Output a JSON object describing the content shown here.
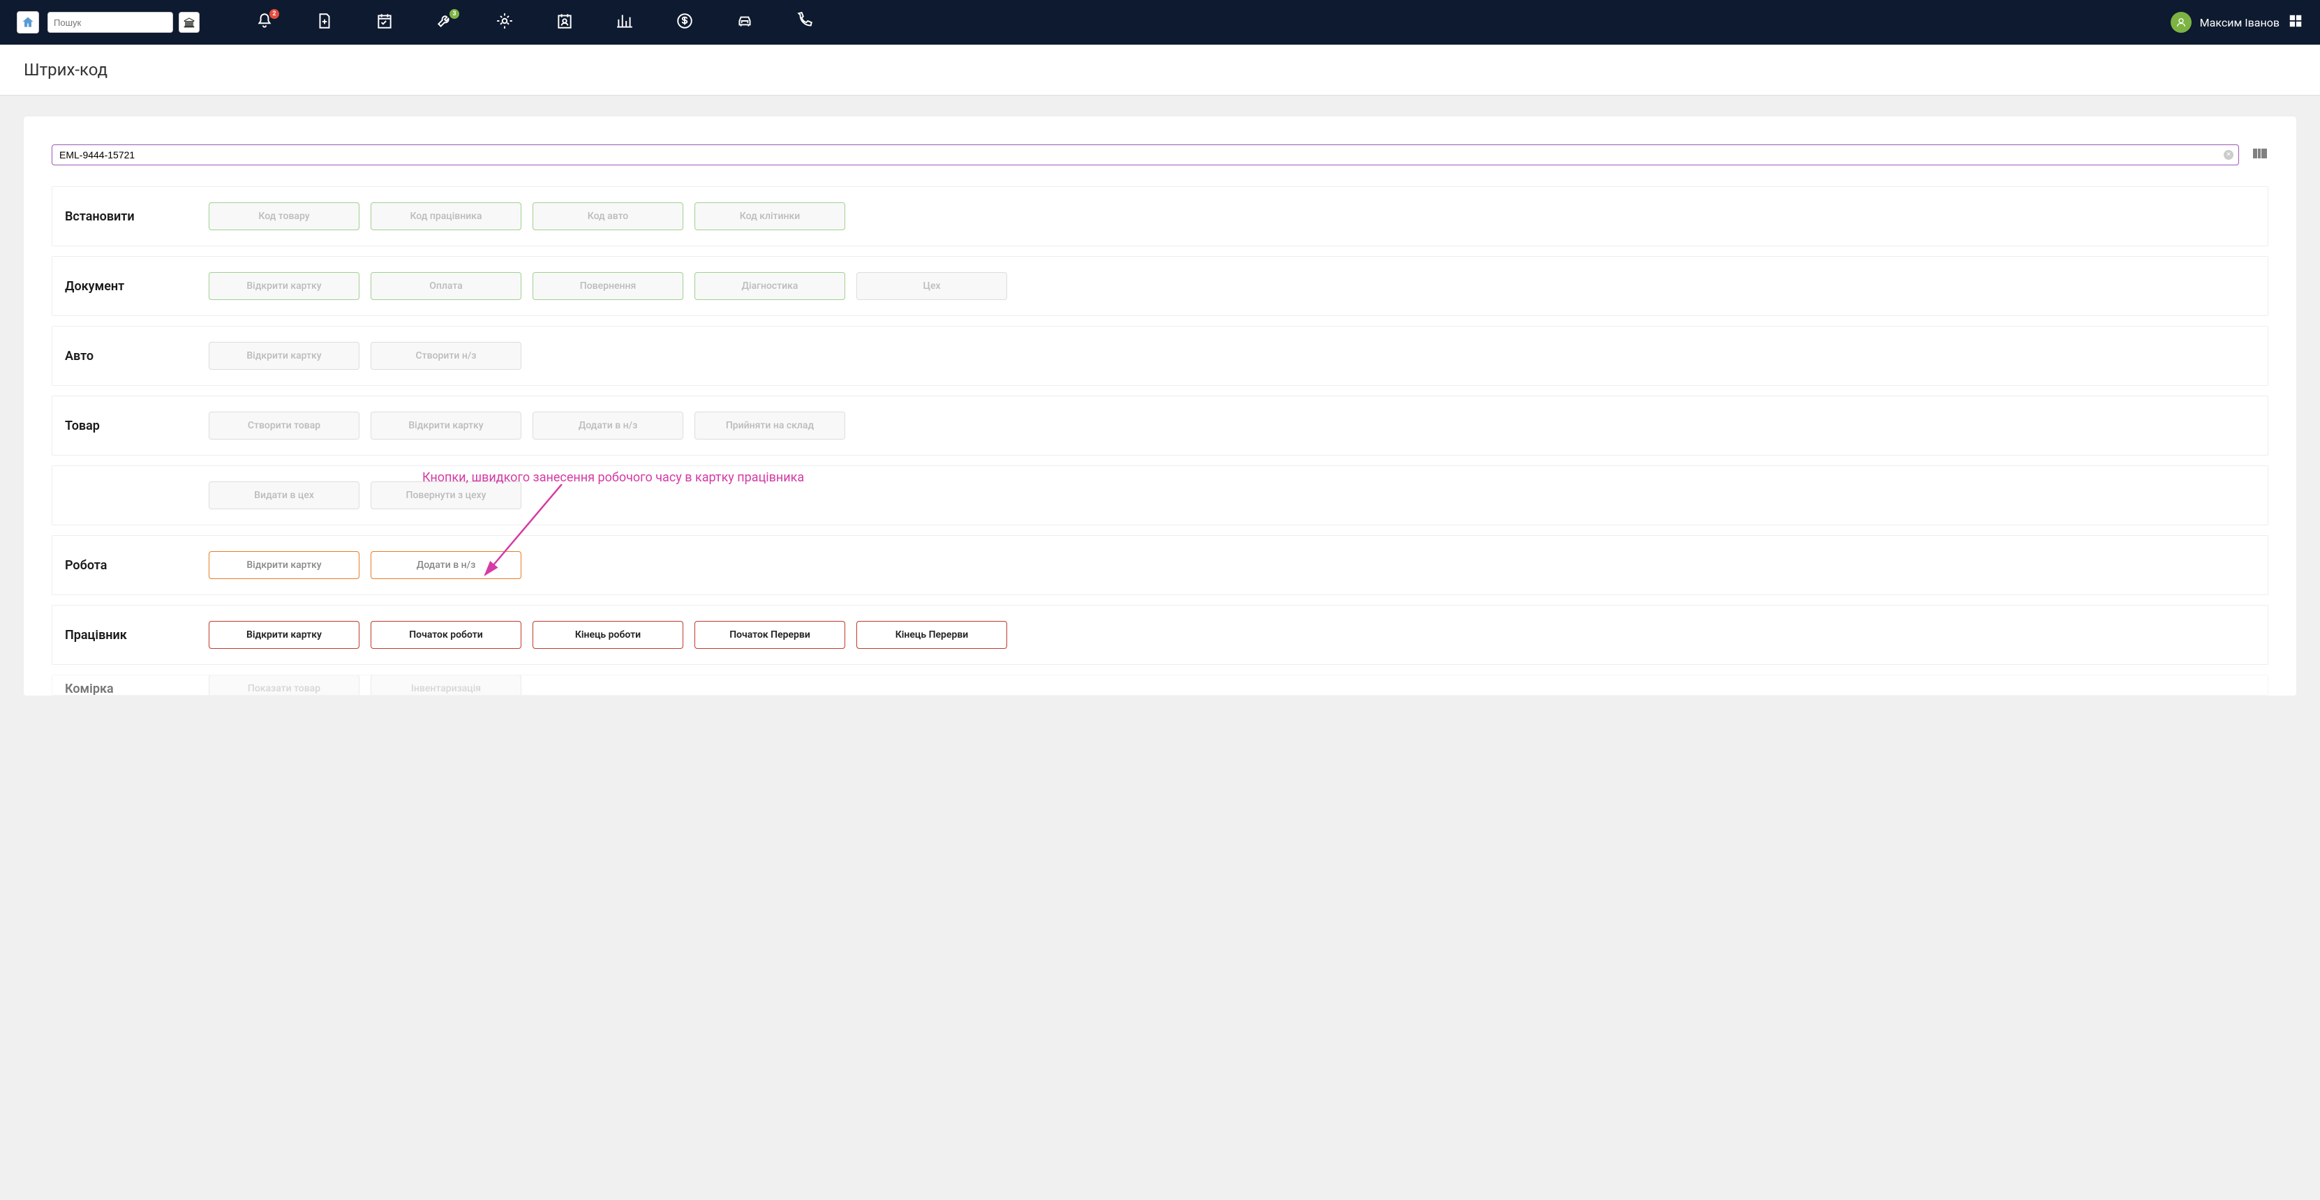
{
  "header": {
    "search_placeholder": "Пошук",
    "user_name": "Максим Іванов",
    "badge_bell": "2",
    "badge_wrench": "3"
  },
  "page_title": "Штрих-код",
  "barcode_value": "EML-9444-15721",
  "sections": {
    "set": {
      "label": "Встановити",
      "b1": "Код товару",
      "b2": "Код працівника",
      "b3": "Код авто",
      "b4": "Код клітинки"
    },
    "doc": {
      "label": "Документ",
      "b1": "Відкрити картку",
      "b2": "Оплата",
      "b3": "Повернення",
      "b4": "Діагностика",
      "b5": "Цех"
    },
    "auto": {
      "label": "Авто",
      "b1": "Відкрити картку",
      "b2": "Створити н/з"
    },
    "product": {
      "label": "Товар",
      "b1": "Створити товар",
      "b2": "Відкрити картку",
      "b3": "Додати в н/з",
      "b4": "Прийняти на склад"
    },
    "product2": {
      "b1": "Видати в цех",
      "b2": "Повернути з цеху"
    },
    "work": {
      "label": "Робота",
      "b1": "Відкрити картку",
      "b2": "Додати в н/з"
    },
    "employee": {
      "label": "Працівник",
      "b1": "Відкрити картку",
      "b2": "Початок роботи",
      "b3": "Кінець роботи",
      "b4": "Початок Перерви",
      "b5": "Кінець Перерви"
    },
    "cell": {
      "label": "Комірка",
      "b1": "Показати товар",
      "b2": "Інвентаризація"
    }
  },
  "annotation": "Кнопки, швидкого занесення робочого часу в картку працівника"
}
